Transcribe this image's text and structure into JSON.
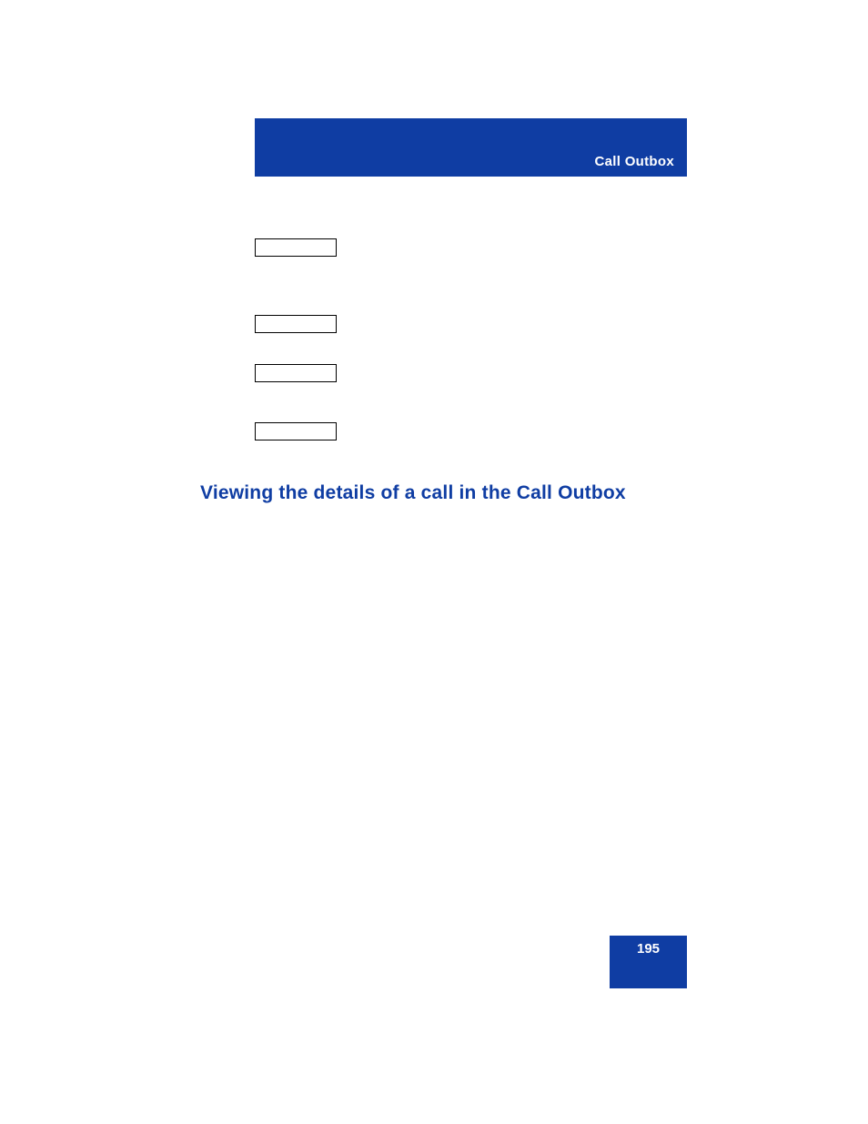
{
  "header": {
    "title": "Call Outbox"
  },
  "section": {
    "heading": "Viewing the details of a call in the Call Outbox"
  },
  "footer": {
    "page_number": "195"
  }
}
